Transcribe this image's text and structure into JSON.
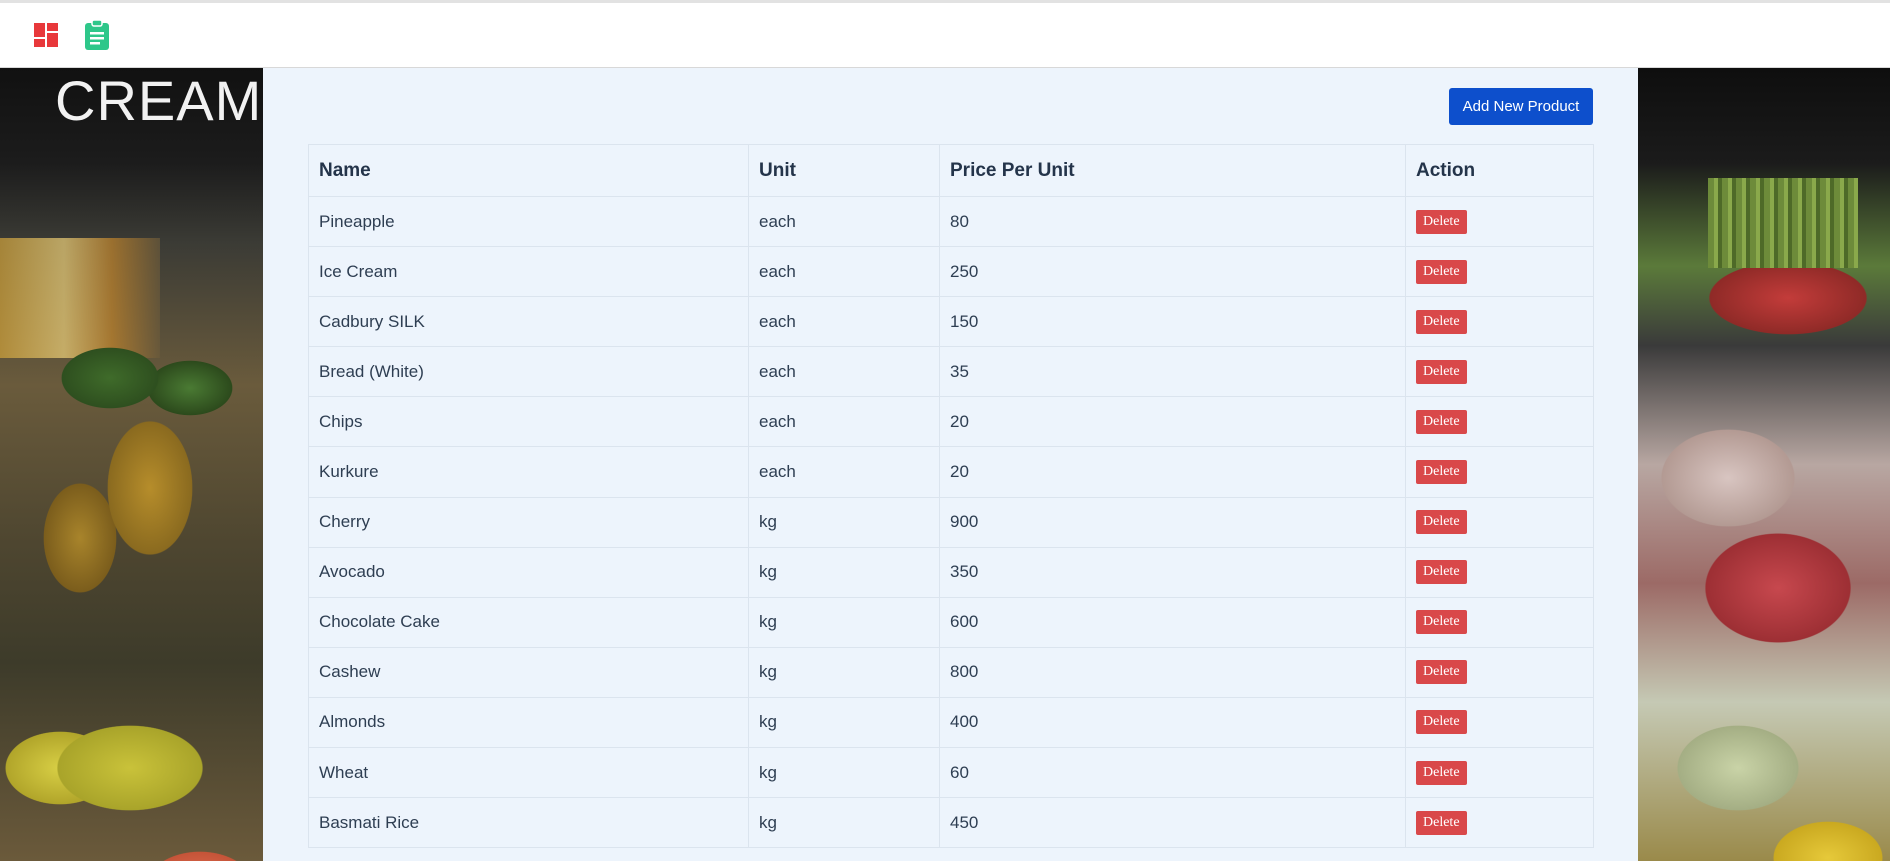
{
  "nav": {
    "icons": [
      "dashboard-icon",
      "clipboard-icon"
    ]
  },
  "background": {
    "sign_text": "CREAM"
  },
  "toolbar": {
    "add_label": "Add New Product"
  },
  "table": {
    "headers": [
      "Name",
      "Unit",
      "Price Per Unit",
      "Action"
    ],
    "rows": [
      {
        "name": "Pineapple",
        "unit": "each",
        "price": "80",
        "action": "Delete"
      },
      {
        "name": "Ice Cream",
        "unit": "each",
        "price": "250",
        "action": "Delete"
      },
      {
        "name": "Cadbury SILK",
        "unit": "each",
        "price": "150",
        "action": "Delete"
      },
      {
        "name": "Bread (White)",
        "unit": "each",
        "price": "35",
        "action": "Delete"
      },
      {
        "name": "Chips",
        "unit": "each",
        "price": "20",
        "action": "Delete"
      },
      {
        "name": "Kurkure",
        "unit": "each",
        "price": "20",
        "action": "Delete"
      },
      {
        "name": "Cherry",
        "unit": "kg",
        "price": "900",
        "action": "Delete"
      },
      {
        "name": "Avocado",
        "unit": "kg",
        "price": "350",
        "action": "Delete"
      },
      {
        "name": "Chocolate Cake",
        "unit": "kg",
        "price": "600",
        "action": "Delete"
      },
      {
        "name": "Cashew",
        "unit": "kg",
        "price": "800",
        "action": "Delete"
      },
      {
        "name": "Almonds",
        "unit": "kg",
        "price": "400",
        "action": "Delete"
      },
      {
        "name": "Wheat",
        "unit": "kg",
        "price": "60",
        "action": "Delete"
      },
      {
        "name": "Basmati Rice",
        "unit": "kg",
        "price": "450",
        "action": "Delete"
      }
    ]
  },
  "colors": {
    "accent": "#0d4fcc",
    "danger": "#d9484a",
    "dashboard_icon": "#e8383b",
    "clipboard_icon": "#2ec78a",
    "panel_bg": "#edf4fc"
  }
}
